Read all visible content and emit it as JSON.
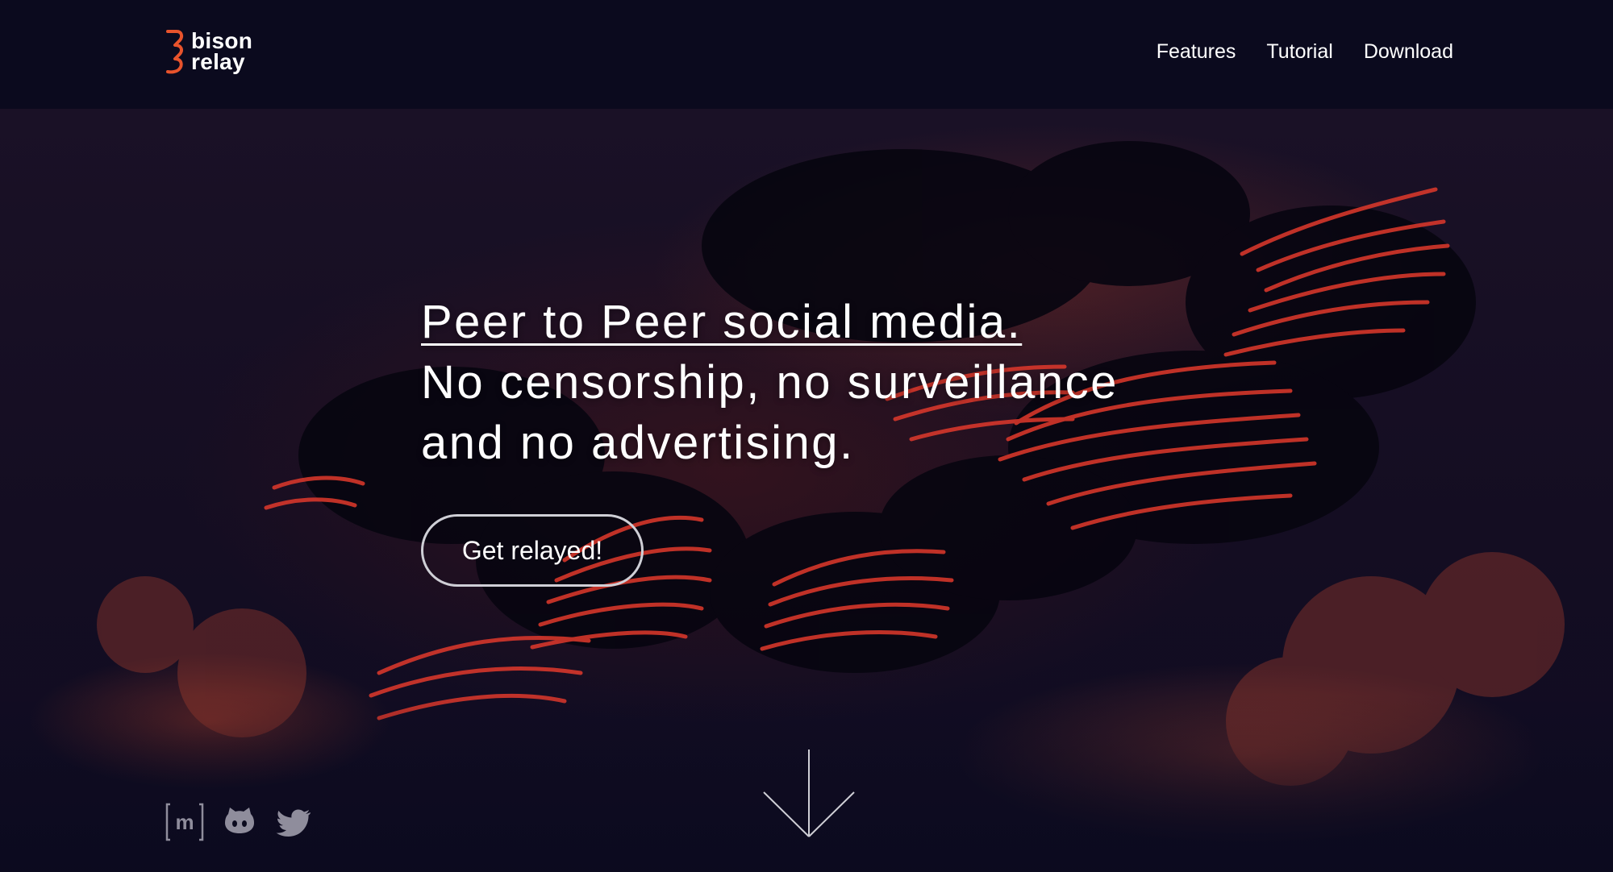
{
  "brand": {
    "name_line1": "bison",
    "name_line2": "relay",
    "accent_color": "#e8532c"
  },
  "nav": {
    "items": [
      {
        "label": "Features"
      },
      {
        "label": "Tutorial"
      },
      {
        "label": "Download"
      }
    ]
  },
  "hero": {
    "headline_line1": "Peer to Peer social media.",
    "headline_line2": "No censorship, no surveillance",
    "headline_line3": "and no advertising.",
    "cta_label": "Get relayed!"
  },
  "social": {
    "icons": [
      "matrix-icon",
      "github-icon",
      "twitter-icon"
    ],
    "icon_color": "#8f8d9c"
  },
  "colors": {
    "background": "#0b0a1e",
    "text": "#ffffff",
    "glow_red": "#e0392c"
  }
}
